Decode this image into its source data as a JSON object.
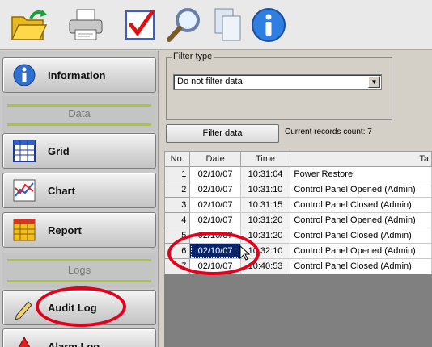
{
  "toolbar": {
    "buttons": [
      {
        "name": "open-folder",
        "icon": "folder-open-icon"
      },
      {
        "name": "print",
        "icon": "printer-icon"
      },
      {
        "name": "check",
        "icon": "checkmark-icon"
      },
      {
        "name": "search",
        "icon": "magnifier-icon"
      },
      {
        "name": "copy",
        "icon": "documents-icon"
      },
      {
        "name": "info",
        "icon": "info-icon"
      }
    ]
  },
  "sidebar": {
    "information_label": "Information",
    "data_section": "Data",
    "grid_label": "Grid",
    "chart_label": "Chart",
    "report_label": "Report",
    "logs_section": "Logs",
    "audit_log_label": "Audit Log",
    "alarm_log_label": "Alarm Log"
  },
  "filter": {
    "legend": "Filter type",
    "selected": "Do not filter data",
    "button_label": "Filter data",
    "records_text": "Current records count: 7"
  },
  "table": {
    "headers": [
      "No.",
      "Date",
      "Time",
      "Ta"
    ],
    "rows": [
      [
        "1",
        "02/10/07",
        "10:31:04",
        "Power Restore"
      ],
      [
        "2",
        "02/10/07",
        "10:31:10",
        "Control Panel Opened (Admin)"
      ],
      [
        "3",
        "02/10/07",
        "10:31:15",
        "Control Panel Closed (Admin)"
      ],
      [
        "4",
        "02/10/07",
        "10:31:20",
        "Control Panel Opened (Admin)"
      ],
      [
        "5",
        "02/10/07",
        "10:31:20",
        "Control Panel Closed (Admin)"
      ],
      [
        "6",
        "02/10/07",
        "10:32:10",
        "Control Panel Opened (Admin)"
      ],
      [
        "7",
        "02/10/07",
        "10:40:53",
        "Control Panel Closed (Admin)"
      ]
    ],
    "selected_row": 6
  },
  "colors": {
    "accent_green": "#a8c63a",
    "annotation_red": "#e4001b",
    "selection_blue": "#0a246a"
  }
}
